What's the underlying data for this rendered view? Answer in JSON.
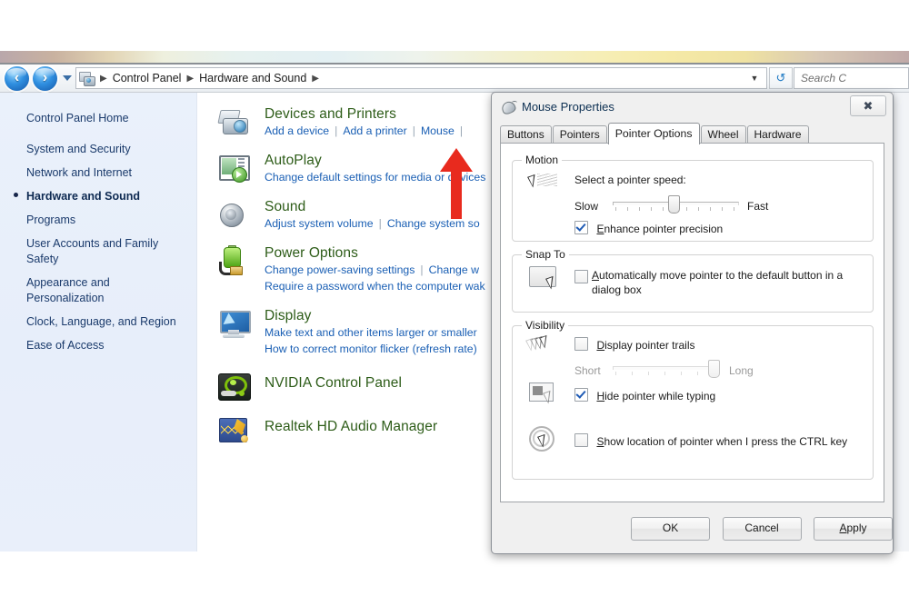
{
  "window": {
    "address_bar": {
      "back_icon": "back-arrow-icon",
      "forward_icon": "forward-arrow-icon",
      "history_dropdown_icon": "chevron-down-icon",
      "breadcrumbs": [
        "Control Panel",
        "Hardware and Sound"
      ],
      "breadcrumb_separator": "▶",
      "dropdown_icon": "chevron-down-icon",
      "refresh_icon": "refresh-icon",
      "search_placeholder": "Search C"
    }
  },
  "sidebar": {
    "home_label": "Control Panel Home",
    "items": [
      {
        "label": "System and Security",
        "selected": false
      },
      {
        "label": "Network and Internet",
        "selected": false
      },
      {
        "label": "Hardware and Sound",
        "selected": true
      },
      {
        "label": "Programs",
        "selected": false
      },
      {
        "label": "User Accounts and Family Safety",
        "selected": false
      },
      {
        "label": "Appearance and Personalization",
        "selected": false
      },
      {
        "label": "Clock, Language, and Region",
        "selected": false
      },
      {
        "label": "Ease of Access",
        "selected": false
      }
    ]
  },
  "categories": [
    {
      "title": "Devices and Printers",
      "icon": "printer-icon",
      "links_rows": [
        [
          "Add a device",
          "Add a printer",
          "Mouse",
          ""
        ]
      ]
    },
    {
      "title": "AutoPlay",
      "icon": "autoplay-icon",
      "links_rows": [
        [
          "Change default settings for media or devices"
        ]
      ]
    },
    {
      "title": "Sound",
      "icon": "speaker-icon",
      "links_rows": [
        [
          "Adjust system volume",
          "Change system so"
        ]
      ]
    },
    {
      "title": "Power Options",
      "icon": "battery-icon",
      "links_rows": [
        [
          "Change power-saving settings",
          "Change w"
        ],
        [
          "Require a password when the computer wak"
        ]
      ]
    },
    {
      "title": "Display",
      "icon": "monitor-icon",
      "links_rows": [
        [
          "Make text and other items larger or smaller"
        ],
        [
          "How to correct monitor flicker (refresh rate)"
        ]
      ]
    },
    {
      "title": "NVIDIA Control Panel",
      "icon": "nvidia-icon",
      "links_rows": []
    },
    {
      "title": "Realtek HD Audio Manager",
      "icon": "realtek-icon",
      "links_rows": []
    }
  ],
  "annotation": {
    "arrow_color": "#e82a1e",
    "points_to": "Mouse"
  },
  "dialog": {
    "title": "Mouse Properties",
    "title_icon": "mouse-icon",
    "close_label": "✖",
    "tabs": [
      {
        "label": "Buttons",
        "active": false
      },
      {
        "label": "Pointers",
        "active": false
      },
      {
        "label": "Pointer Options",
        "active": true
      },
      {
        "label": "Wheel",
        "active": false
      },
      {
        "label": "Hardware",
        "active": false
      }
    ],
    "motion": {
      "legend": "Motion",
      "icon": "pointer-speed-icon",
      "speed_label": "Select a pointer speed:",
      "slow_label": "Slow",
      "fast_label": "Fast",
      "slider_value": 5,
      "slider_min": 1,
      "slider_max": 10,
      "tick_count": 11,
      "enhance_label": "Enhance pointer precision",
      "enhance_checked": true
    },
    "snap_to": {
      "legend": "Snap To",
      "icon": "snap-to-button-icon",
      "auto_move_label": "Automatically move pointer to the default button in a dialog box",
      "auto_move_checked": false
    },
    "visibility": {
      "legend": "Visibility",
      "trails_icon": "pointer-trails-icon",
      "trails_label": "Display pointer trails",
      "trails_checked": false,
      "short_label": "Short",
      "long_label": "Long",
      "trails_slider_value": 9,
      "trails_slider_min": 1,
      "trails_slider_max": 10,
      "trails_tick_count": 7,
      "hide_typing_icon": "hide-pointer-typing-icon",
      "hide_typing_label": "Hide pointer while typing",
      "hide_typing_checked": true,
      "ctrl_icon": "pointer-location-icon",
      "ctrl_label": "Show location of pointer when I press the CTRL key",
      "ctrl_checked": false
    },
    "buttons": {
      "ok": "OK",
      "cancel": "Cancel",
      "apply": "Apply"
    }
  },
  "colors": {
    "category_title": "#2d5c18",
    "link": "#1a5fb4",
    "sidebar_text": "#1a3a6b",
    "sidebar_bg": "#e9effa",
    "accent_arrow": "#e82a1e"
  }
}
